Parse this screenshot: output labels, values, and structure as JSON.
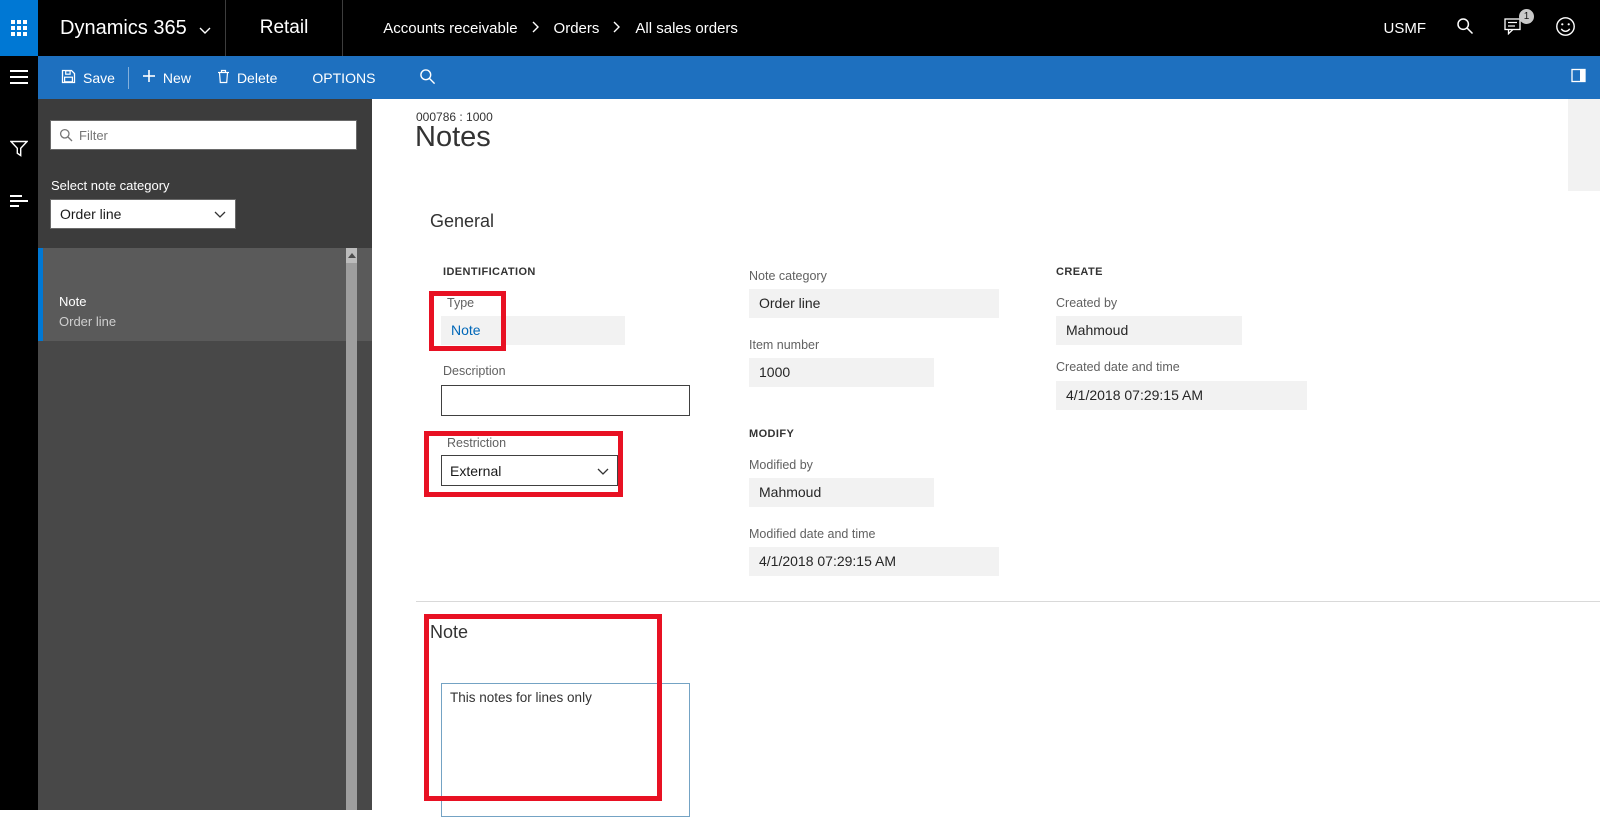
{
  "colors": {
    "topbar_black": "#000000",
    "waffle_blue": "#0078d4",
    "ribbon_blue": "#1e70bf",
    "panel_gray": "#3c3c3c",
    "selected_accent_blue": "#0078d4",
    "link_blue": "#0067b8",
    "annotation_red": "#e81123"
  },
  "topbar": {
    "app_name": "Dynamics 365",
    "module": "Retail",
    "breadcrumb": [
      "Accounts receivable",
      "Orders",
      "All sales orders"
    ],
    "company": "USMF",
    "notification_badge": "1"
  },
  "toolbar": {
    "save_label": "Save",
    "new_label": "New",
    "delete_label": "Delete",
    "options_label": "OPTIONS"
  },
  "left_panel": {
    "filter_placeholder": "Filter",
    "category_label": "Select note category",
    "category_value": "Order line",
    "items": [
      {
        "title": "Note",
        "subtitle": "Order line"
      }
    ]
  },
  "main": {
    "record_id": "000786 : 1000",
    "page_title": "Notes",
    "general": {
      "title": "General",
      "identification_header": "IDENTIFICATION",
      "type_label": "Type",
      "type_value": "Note",
      "description_label": "Description",
      "description_value": "",
      "restriction_label": "Restriction",
      "restriction_value": "External",
      "note_category_label": "Note category",
      "note_category_value": "Order line",
      "item_number_label": "Item number",
      "item_number_value": "1000",
      "modify_header": "MODIFY",
      "modified_by_label": "Modified by",
      "modified_by_value": "Mahmoud",
      "modified_date_label": "Modified date and time",
      "modified_date_value": "4/1/2018 07:29:15 AM",
      "create_header": "CREATE",
      "created_by_label": "Created by",
      "created_by_value": "Mahmoud",
      "created_date_label": "Created date and time",
      "created_date_value": "4/1/2018 07:29:15 AM"
    },
    "note_section": {
      "title": "Note",
      "note_text": "This notes for lines only"
    }
  }
}
